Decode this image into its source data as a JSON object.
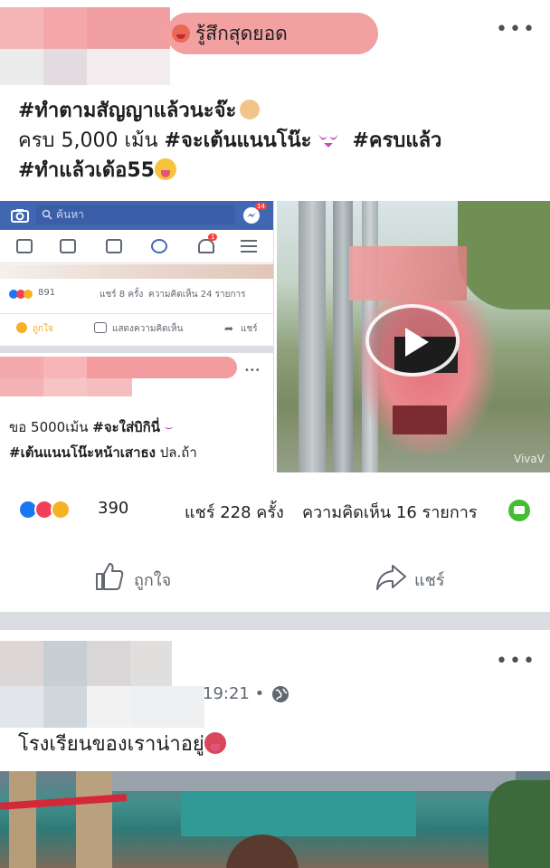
{
  "post1": {
    "feeling": "รู้สึกสุดยอด",
    "more": "•••",
    "caption": {
      "line1": "#ทำตามสัญญาแล้วนะจ๊ะ",
      "line2_prefix": "ครบ 5,000 เม้น",
      "line2_tag1": "#จะเต้นแนนโน๊ะ",
      "line2_tag2": "#ครบแล้ว",
      "line3": "#ทำแล้วเด้อ55"
    },
    "embed": {
      "search_placeholder": "ค้นหา",
      "notif_badge": "14",
      "bell_badge": "1",
      "reaction_count": "891",
      "shares": "แชร์ 8 ครั้ง",
      "comments": "ความคิดเห็น 24 รายการ",
      "like": "ถูกใจ",
      "comment": "แสดงความคิดเห็น",
      "share": "แชร์",
      "more": "•••",
      "inner_caption_line1_prefix": "ขอ 5000เม้น",
      "inner_caption_line1_tag": "#จะใส่บิกินี่",
      "inner_caption_line2_tag": "#เต้นแนนโน๊ะหน้าเสาธง",
      "inner_caption_line2_suffix": "ปล.ถ้า"
    },
    "video_watermark": "VivaV",
    "reaction_count": "390",
    "shares": "แชร์ 228 ครั้ง",
    "comments": "ความคิดเห็น 16 รายการ",
    "like_label": "ถูกใจ",
    "share_label": "แชร์"
  },
  "post2": {
    "timestamp": "19:21 •",
    "more": "•••",
    "caption": "โรงเรียนของเราน่าอยู่"
  },
  "colors": {
    "fb_blue": "#4267b2",
    "like_blue": "#1877f2",
    "love_red": "#f33e58",
    "haha_yellow": "#f7b125",
    "divider": "#dadde1",
    "messenger_green": "#44bd32"
  },
  "icons": [
    "camera-icon",
    "search-icon",
    "messenger-icon",
    "news-feed-icon",
    "video-icon",
    "marketplace-icon",
    "profile-icon",
    "bell-icon",
    "menu-icon",
    "like-icon",
    "share-icon",
    "globe-icon",
    "play-icon",
    "comment-icon"
  ]
}
